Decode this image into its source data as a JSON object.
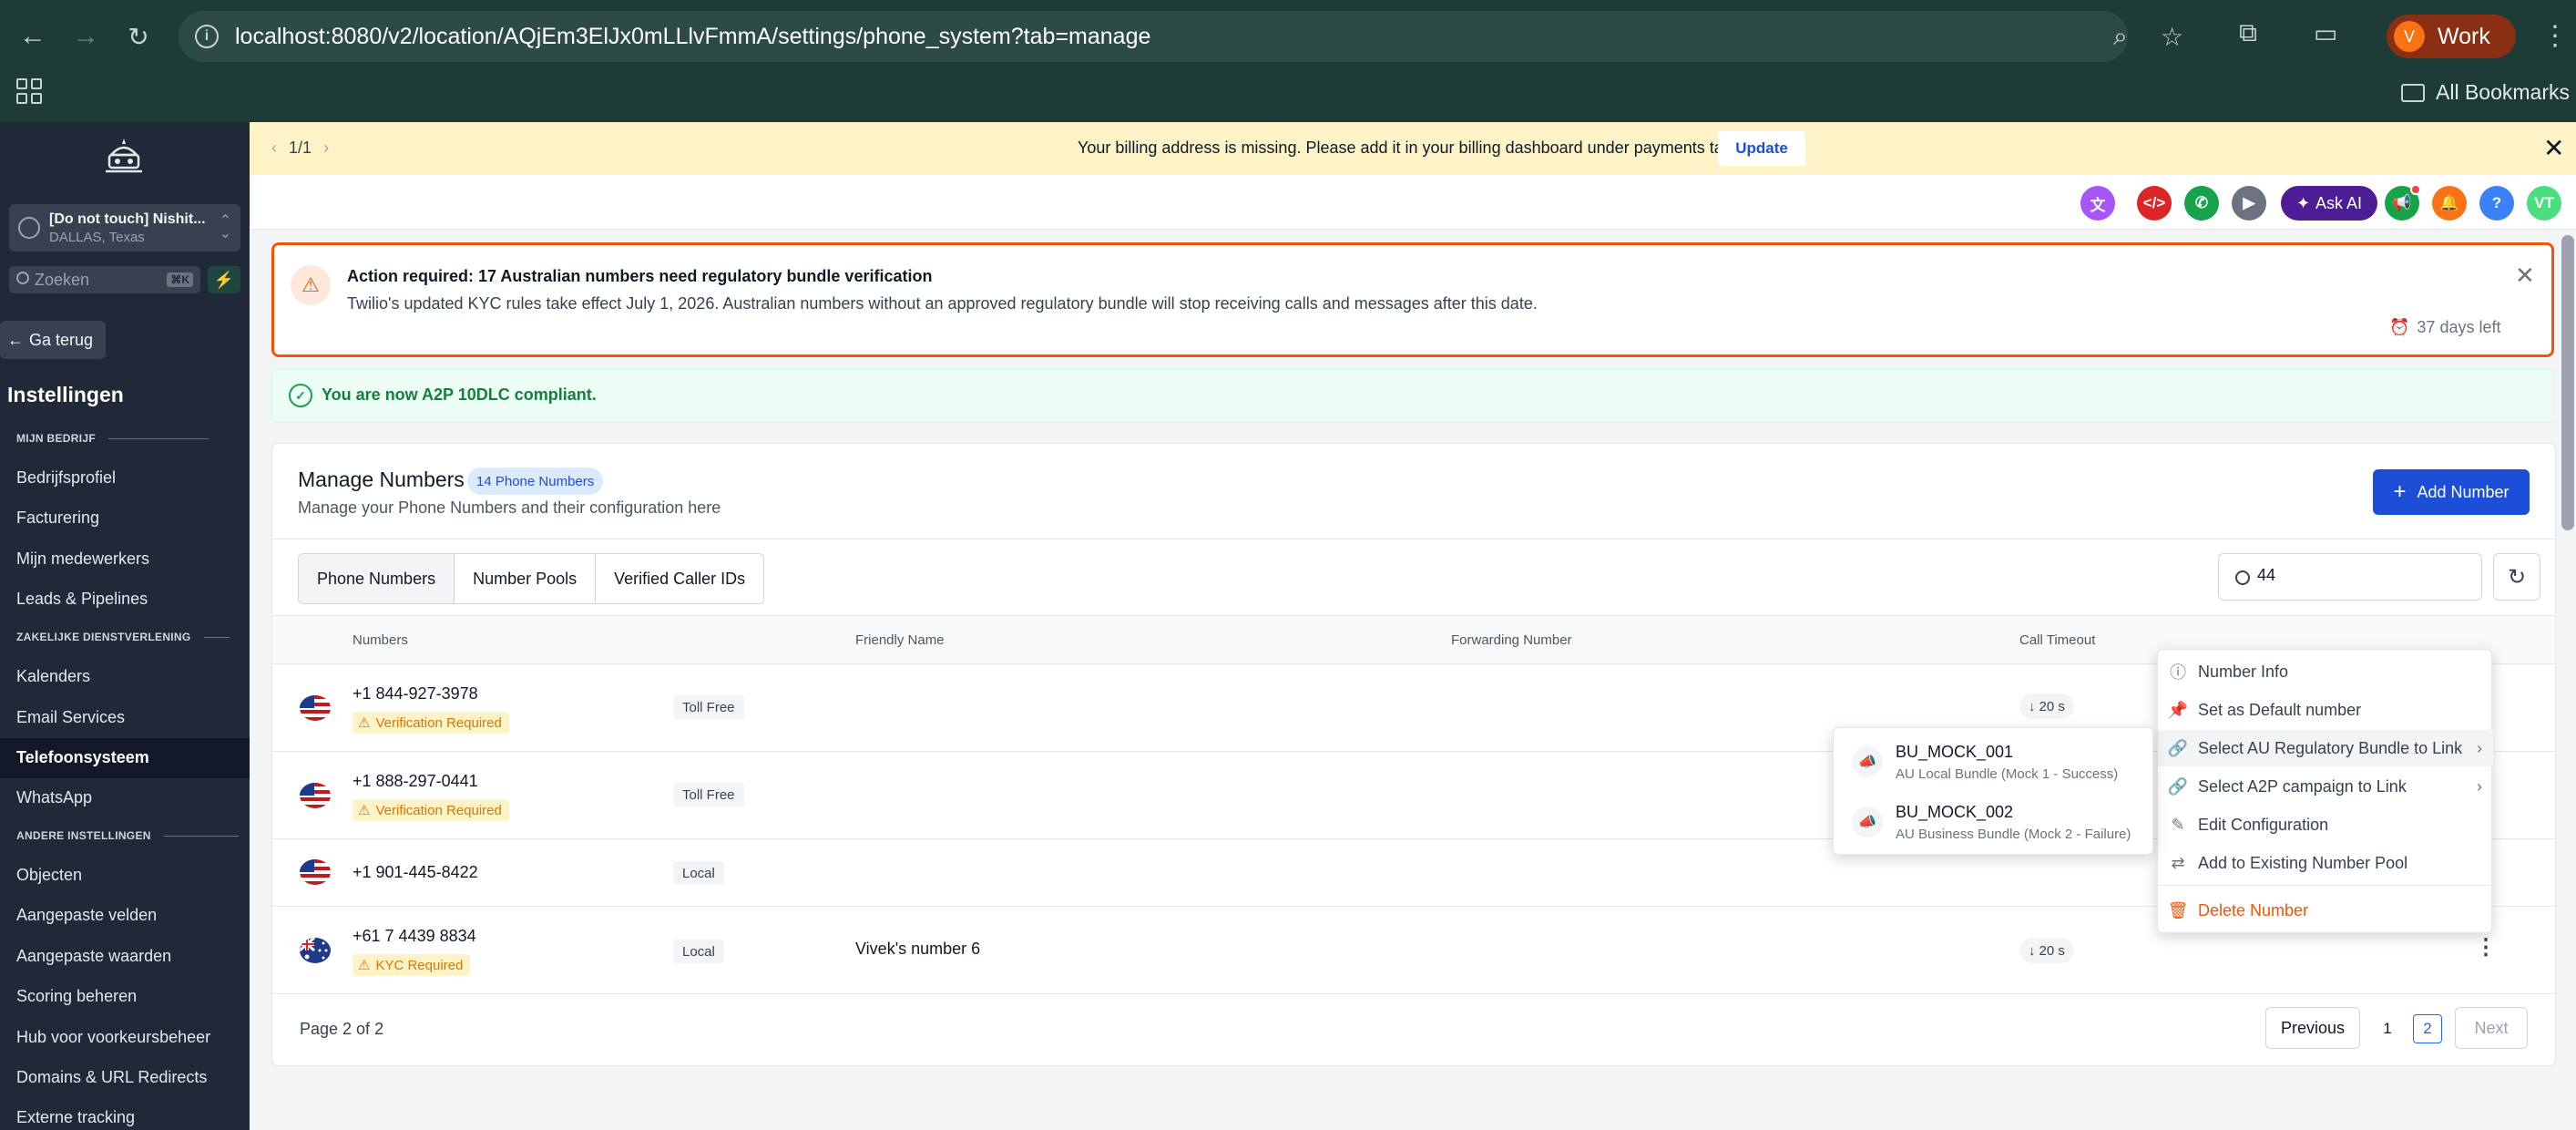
{
  "browser": {
    "url": "localhost:8080/v2/location/AQjEm3ElJx0mLLlvFmmA/settings/phone_system?tab=manage",
    "profile_initial": "V",
    "profile_label": "Work",
    "bookmarks_label": "All Bookmarks"
  },
  "sidebar": {
    "location_name": "[Do not touch] Nishit...",
    "location_sub": "DALLAS, Texas",
    "search_placeholder": "Zoeken",
    "search_shortcut": "⌘K",
    "back_label": "Ga terug",
    "title": "Instellingen",
    "sections": [
      {
        "label": "MIJN BEDRIJF",
        "items": [
          "Bedrijfsprofiel",
          "Facturering",
          "Mijn medewerkers",
          "Leads & Pipelines"
        ]
      },
      {
        "label": "ZAKELIJKE DIENSTVERLENING",
        "items": [
          "Kalenders",
          "Email Services",
          "Telefoonsysteem",
          "WhatsApp"
        ]
      },
      {
        "label": "ANDERE INSTELLINGEN",
        "items": [
          "Objecten",
          "Aangepaste velden",
          "Aangepaste waarden",
          "Scoring beheren",
          "Hub voor voorkeursbeheer",
          "Domains & URL Redirects",
          "Externe tracking"
        ]
      }
    ],
    "active_item": "Telefoonsysteem"
  },
  "billing_banner": {
    "pager": "1/1",
    "message": "Your billing address is missing. Please add it in your billing dashboard under payments tab",
    "update_label": "Update"
  },
  "header": {
    "ask_ai_label": "Ask AI",
    "help_label": "?",
    "avatar_initials": "VT"
  },
  "alert": {
    "title": "Action required: 17 Australian numbers need regulatory bundle verification",
    "body": "Twilio's updated KYC rules take effect July 1, 2026. Australian numbers without an approved regulatory bundle will stop receiving calls and messages after this date.",
    "days_left": "37 days left"
  },
  "a2p_banner": {
    "message": "You are now A2P 10DLC compliant."
  },
  "manage": {
    "title": "Manage Numbers",
    "count_badge": "14 Phone Numbers",
    "subtitle": "Manage your Phone Numbers and their configuration here",
    "add_button": "Add Number",
    "tabs": [
      "Phone Numbers",
      "Number Pools",
      "Verified Caller IDs"
    ],
    "search_value": "44",
    "columns": [
      "Numbers",
      "Friendly Name",
      "Forwarding Number",
      "Call Timeout"
    ],
    "rows": [
      {
        "flag": "us",
        "number": "+1 844-927-3978",
        "warning": "Verification Required",
        "type": "Toll Free",
        "friendly": "",
        "timeout": "20 s"
      },
      {
        "flag": "us",
        "number": "+1 888-297-0441",
        "warning": "Verification Required",
        "type": "Toll Free",
        "friendly": "",
        "timeout": ""
      },
      {
        "flag": "us",
        "number": "+1 901-445-8422",
        "warning": "",
        "type": "Local",
        "friendly": "",
        "timeout": ""
      },
      {
        "flag": "au",
        "number": "+61 7 4439 8834",
        "warning": "KYC Required",
        "type": "Local",
        "friendly": "Vivek's number 6",
        "timeout": "20 s"
      }
    ],
    "page_info": "Page 2 of 2",
    "previous_label": "Previous",
    "next_label": "Next",
    "pages": [
      "1",
      "2"
    ],
    "current_page": "2"
  },
  "context_menu": {
    "items": [
      "Number Info",
      "Set as Default number",
      "Select AU Regulatory Bundle to Link",
      "Select A2P campaign to Link",
      "Edit Configuration",
      "Add to Existing Number Pool"
    ],
    "delete_label": "Delete Number"
  },
  "bundle_submenu": {
    "items": [
      {
        "name": "BU_MOCK_001",
        "desc": "AU Local Bundle (Mock 1 - Success)"
      },
      {
        "name": "BU_MOCK_002",
        "desc": "AU Business Bundle (Mock 2 - Failure)"
      }
    ]
  },
  "colors": {
    "sidebar_bg": "#1f2937",
    "accent": "#1d4ed8",
    "alert_border": "#ea580c",
    "success": "#15803d",
    "warning": "#d97706"
  }
}
